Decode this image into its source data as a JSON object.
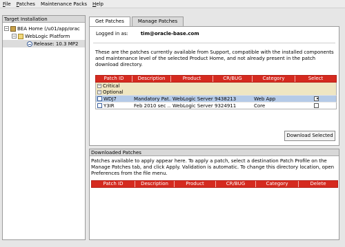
{
  "menu": [
    {
      "label": "File",
      "mnemonic": "F",
      "rest": "ile"
    },
    {
      "label": "Patches",
      "mnemonic": "P",
      "rest": "atches"
    },
    {
      "label": "Maintenance Packs",
      "mnemonic": "",
      "rest": "Maintenance Packs"
    },
    {
      "label": "Help",
      "mnemonic": "H",
      "rest": "elp"
    }
  ],
  "left_panel": {
    "title": "Target Installation",
    "tree": {
      "home": "BEA Home (/u01/app/orac",
      "platform": "WebLogic Platform",
      "release": "Release: 10.3 MP2"
    }
  },
  "tabs": {
    "get_patches": "Get Patches",
    "manage_patches": "Manage Patches"
  },
  "top_panel": {
    "logged_in_label": "Logged in as:",
    "logged_in_user": "tim@oracle-base.com",
    "description": "These are the patches currently available from Support, compatible with the installed components and maintenance level of the selected Product Home, and not already present in the patch download directory.",
    "columns": [
      "Patch ID",
      "Description",
      "Product",
      "CR/BUG",
      "Category",
      "Select"
    ],
    "groups": {
      "critical": "Critical",
      "optional": "Optional"
    },
    "rows": [
      {
        "id": "WDJ7",
        "description": "Mandatory Pat...",
        "product": "WebLogic Server",
        "crbug": "9438213",
        "category": "Web App",
        "selected": "✔"
      },
      {
        "id": "Y3IR",
        "description": "Feb 2010 sec ...",
        "product": "WebLogic Server",
        "crbug": "9324911",
        "category": "Core",
        "selected": ""
      }
    ],
    "download_button": "Download Selected"
  },
  "bottom_panel": {
    "title": "Downloaded Patches",
    "description": "Patches available to apply appear here.  To apply a patch, select a destination Patch Profile on the Manage Patches tab, and click Apply.  Validation is automatic.  To change this directory location, open Preferences from the file menu.",
    "columns": [
      "Patch ID",
      "Description",
      "Product",
      "CR/BUG",
      "Category",
      "Delete"
    ]
  },
  "colors": {
    "header_red": "#d52a1f",
    "selected_row": "#b5cbe8",
    "group_row": "#efe6c2"
  }
}
